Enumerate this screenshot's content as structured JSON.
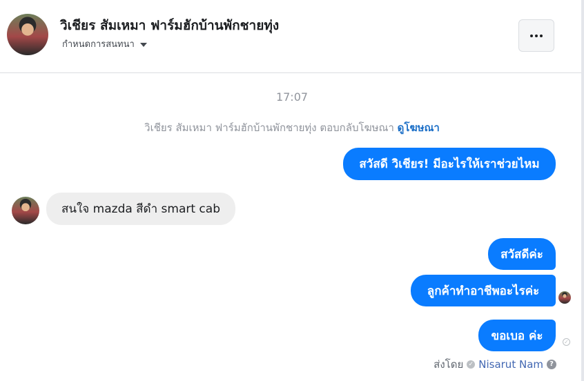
{
  "header": {
    "contact_name": "วิเชียร สัมเหมา ฟาร์มฮักบ้านพักชายทุ่ง",
    "conversation_settings": "กำหนดการสนทนา",
    "more_label": "•••"
  },
  "thread": {
    "timestamp": "17:07",
    "ad_notice": {
      "text": "วิเชียร สัมเหมา ฟาร์มฮักบ้านพักชายทุ่ง ตอบกลับโฆษณา",
      "link": "ดูโฆษณา"
    },
    "messages": [
      {
        "direction": "outgoing",
        "text": "สวัสดี วิเชียร! มีอะไรให้เราช่วยไหม"
      },
      {
        "direction": "incoming",
        "text": "สนใจ mazda สีดำ smart cab"
      },
      {
        "direction": "outgoing",
        "text": "สวัสดีค่ะ"
      },
      {
        "direction": "outgoing",
        "text": "ลูกค้าทำอาชีพอะไรค่ะ"
      },
      {
        "direction": "outgoing",
        "text": "ขอเบอ ค่ะ"
      }
    ],
    "sent_by": {
      "label": "ส่งโดย",
      "sender": "Nisarut Nam"
    }
  },
  "icons": {
    "more": "more-horizontal-icon",
    "caret": "caret-down-icon",
    "verified": "verified-badge-icon",
    "help": "question-mark-icon",
    "delivered": "delivered-check-icon"
  },
  "colors": {
    "outgoing_bubble": "#0a7cff",
    "incoming_bubble": "#eeeeee",
    "link": "#1c6fc7",
    "muted_text": "#90949c"
  }
}
